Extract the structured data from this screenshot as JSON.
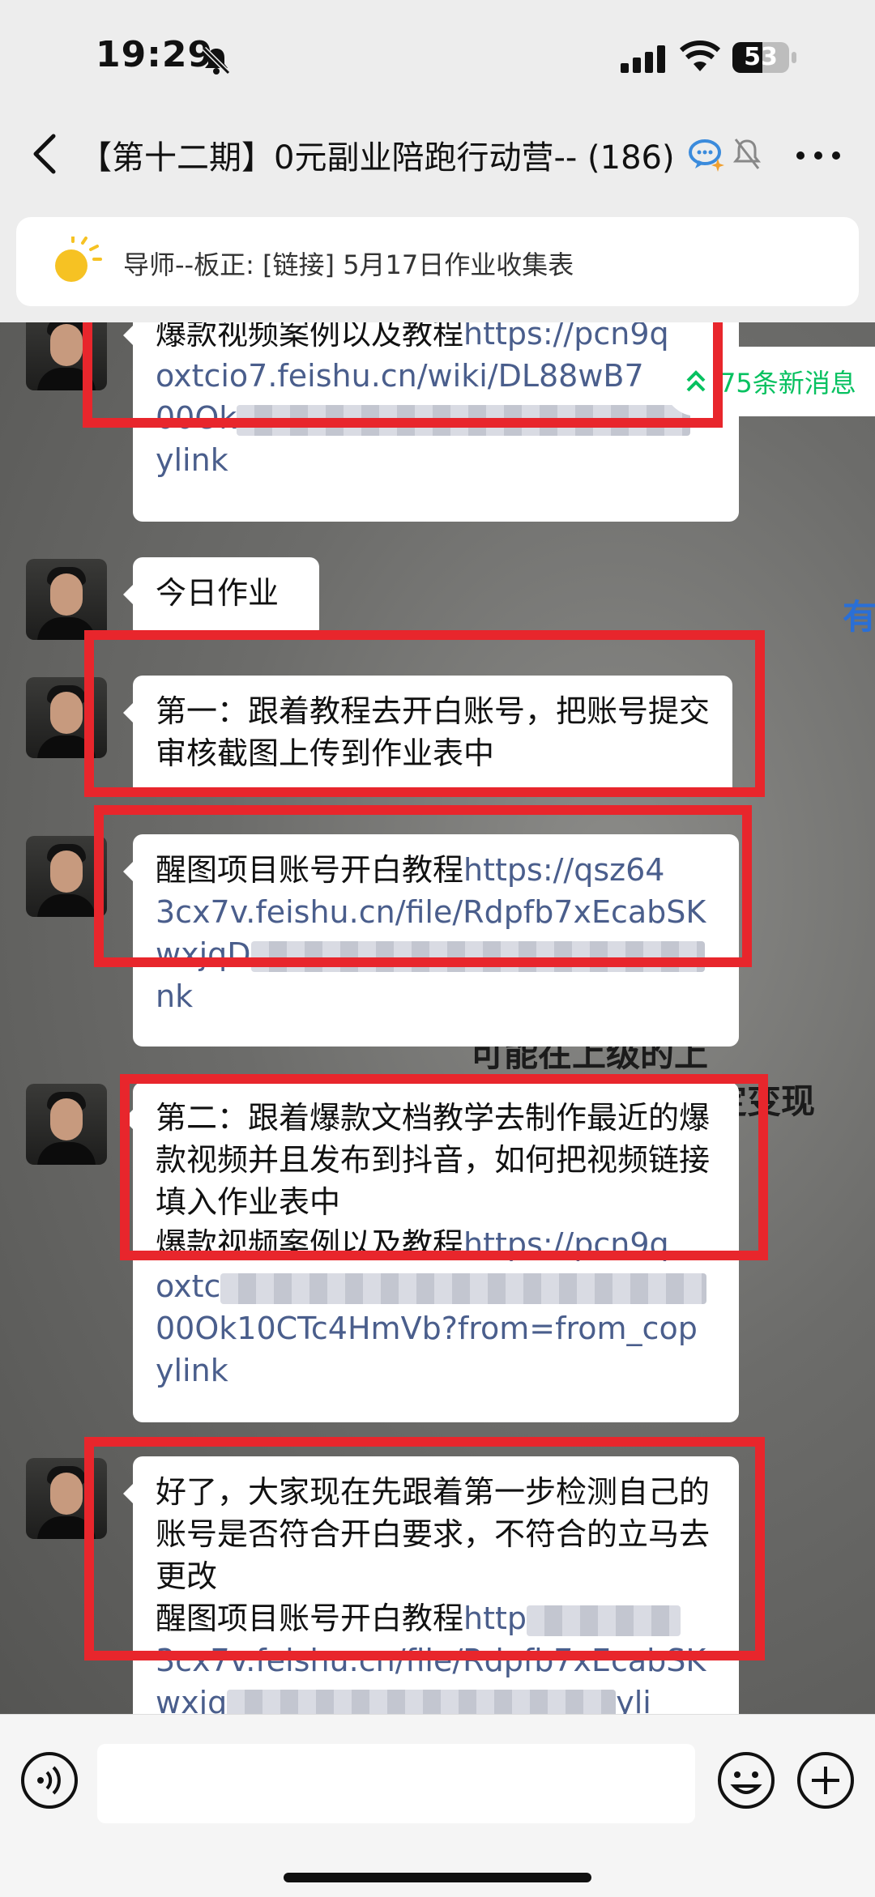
{
  "status_bar": {
    "time": "19:29",
    "battery": "53",
    "battery_level": 0.53
  },
  "header": {
    "back_label": "<",
    "title": "【第十二期】0元副业陪跑行动营-- (186)"
  },
  "pinned": {
    "text": "导师--板正: [链接] 5月17日作业收集表"
  },
  "new_messages": {
    "label": "75条新消息"
  },
  "background_text": [
    "可能在上级的上",
    "定变现",
    "有"
  ],
  "messages": [
    {
      "text": "爆款视频案例以及教程",
      "link_lines": [
        "https://pcn9q",
        "oxtcio7.feishu.cn/wiki/DL88wB7",
        "00Ok",
        "ylink"
      ]
    },
    {
      "text": "今日作业"
    },
    {
      "text": "第一：跟着教程去开白账号，把账号提交审核截图上传到作业表中"
    },
    {
      "text": "醒图项目账号开白教程",
      "link_lines": [
        "https://qsz64",
        "3cx7v.feishu.cn/file/Rdpfb7xEcabSK",
        "wxjqD",
        "nk"
      ]
    },
    {
      "text": "第二：跟着爆款文档教学去制作最近的爆款视频并且发布到抖音，如何把视频链接填入作业表中",
      "text2": "爆款视频案例以及教程",
      "link_lines": [
        "https://pcn9q",
        "oxtc",
        "00Ok10CTc4HmVb?from=from_cop",
        "ylink"
      ]
    },
    {
      "text": "好了，大家现在先跟着第一步检测自己的账号是否符合开白要求，不符合的立马去更改",
      "text2": "醒图项目账号开白教程",
      "link_lines": [
        "http",
        "3cx7v.feishu.cn/file/Rdpfb7xEcabSK",
        "wxjq",
        "yli"
      ]
    }
  ]
}
